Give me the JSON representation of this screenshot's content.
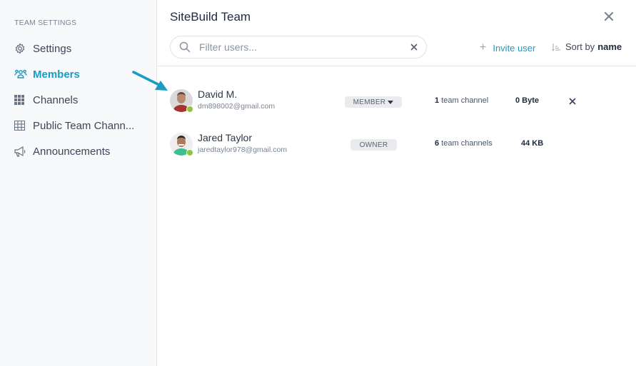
{
  "sidebar": {
    "heading": "TEAM SETTINGS",
    "items": [
      {
        "label": "Settings",
        "icon": "gear-icon",
        "active": false
      },
      {
        "label": "Members",
        "icon": "members-icon",
        "active": true
      },
      {
        "label": "Channels",
        "icon": "grid-icon",
        "active": false
      },
      {
        "label": "Public Team Chann...",
        "icon": "table-icon",
        "active": false
      },
      {
        "label": "Announcements",
        "icon": "megaphone-icon",
        "active": false
      }
    ]
  },
  "header": {
    "title": "SiteBuild Team",
    "close_icon": "close-icon"
  },
  "search": {
    "placeholder": "Filter users...",
    "value": ""
  },
  "toolbar": {
    "invite_label": "Invite user",
    "sort_prefix": "Sort by",
    "sort_value": "name"
  },
  "members": [
    {
      "name": "David M.",
      "email": "dm898002@gmail.com",
      "role": "MEMBER",
      "role_dropdown": true,
      "channel_count": "1",
      "channel_label": "team channel",
      "size": "0 Byte",
      "removable": true,
      "online": true
    },
    {
      "name": "Jared Taylor",
      "email": "jaredtaylor978@gmail.com",
      "role": "OWNER",
      "role_dropdown": false,
      "channel_count": "6",
      "channel_label": "team channels",
      "size": "44 KB",
      "removable": false,
      "online": true
    }
  ],
  "colors": {
    "accent": "#1a9bc1",
    "online": "#8cc63f",
    "annotation_arrow": "#1a9bc1"
  }
}
